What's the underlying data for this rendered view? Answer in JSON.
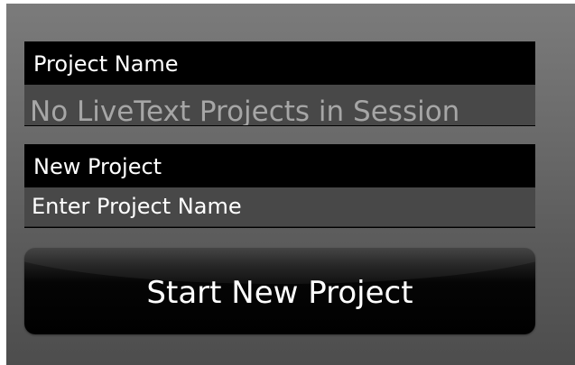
{
  "project_list": {
    "header_label": "Project Name",
    "empty_message": "No LiveText Projects in Session"
  },
  "new_project": {
    "header_label": "New Project",
    "placeholder": "Enter Project Name",
    "value": "Enter Project Name"
  },
  "actions": {
    "start_label": "Start New Project"
  },
  "colors": {
    "panel_background": "#6b6b6b",
    "header_background": "#000000",
    "field_background": "#484848",
    "muted_text": "#a6a6a6",
    "text": "#ffffff"
  }
}
